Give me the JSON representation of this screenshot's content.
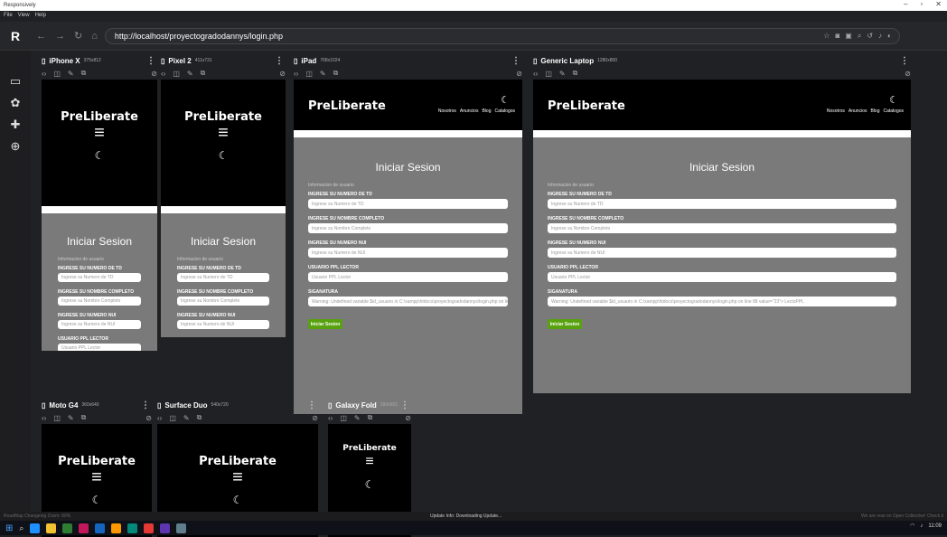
{
  "app": {
    "title": "Responsively",
    "menu": [
      "File",
      "View",
      "Help"
    ]
  },
  "url": "http://localhost/proyectogradodannys/login.php",
  "sidebar": [
    "device-icon",
    "settings-icon",
    "extensions-icon",
    "globe-icon"
  ],
  "site": {
    "brand": "PreLiberate",
    "nav": [
      "Nosotros",
      "Anuncios",
      "Blog",
      "Catalogos"
    ],
    "form_title": "Iniciar Sesion",
    "section": "Informacion de usuario",
    "fields": [
      {
        "label": "INGRESE SU NUMERO DE TD",
        "placeholder": "Ingrese su Numero de TD"
      },
      {
        "label": "INGRESE SU NOMBRE COMPLETO",
        "placeholder": "Ingrese su Nombre Completo"
      },
      {
        "label": "INGRESE SU NUMERO NUI",
        "placeholder": "Ingrese su Numero de NUI"
      },
      {
        "label": "USUARIO PPL LECTOR",
        "placeholder": "Usuario PPL Lector"
      },
      {
        "label": "SIGANATURA",
        "placeholder": "Warning: Undefined variable $id_usuario in C:\\xampp\\htdocs\\proyectogradodannys\\login.php on line 88 value=\"23\"> LectoPPL"
      }
    ],
    "button": "Iniciar Sesion"
  },
  "devices": {
    "iphone": {
      "name": "iPhone X",
      "size": "375x812"
    },
    "pixel": {
      "name": "Pixel 2",
      "size": "411x731"
    },
    "ipad": {
      "name": "iPad",
      "size": "768x1024"
    },
    "laptop": {
      "name": "Generic Laptop",
      "size": "1280x800"
    },
    "moto": {
      "name": "Moto G4",
      "size": "360x640"
    },
    "duo": {
      "name": "Surface Duo",
      "size": "540x720"
    },
    "fold": {
      "name": "Galaxy Fold",
      "size": "280x653"
    }
  },
  "status": {
    "left": "RoadMap  Changelog  Zoom: 60%",
    "center": "Update Info: Downloading Update...",
    "right": "We are now on Open Collective! Check it"
  },
  "tray": {
    "time": "11:09"
  }
}
